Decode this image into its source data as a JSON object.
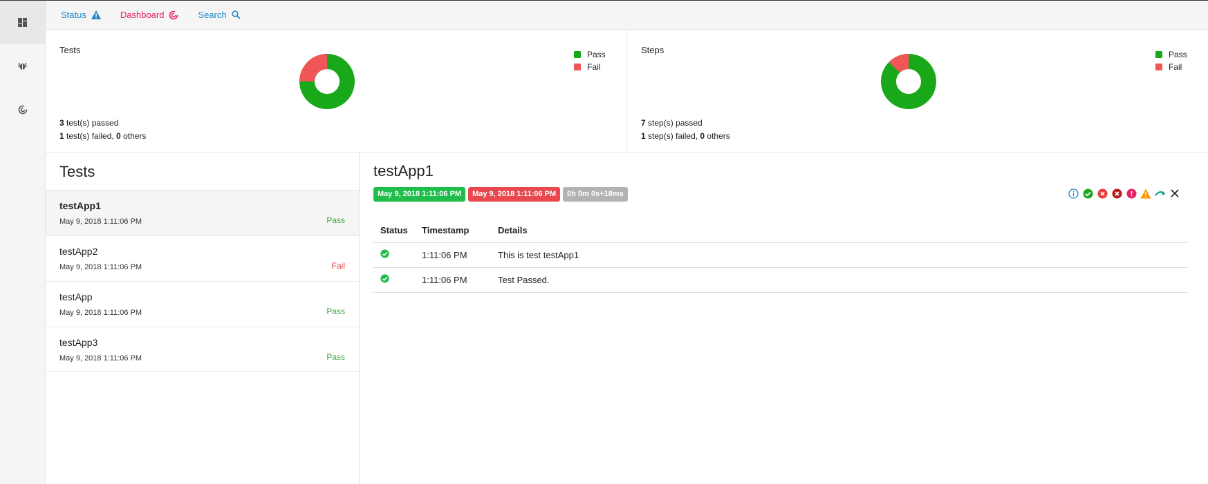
{
  "nav": {
    "status_label": "Status",
    "dashboard_label": "Dashboard",
    "search_label": "Search"
  },
  "colors": {
    "pass": "#19a819",
    "fail": "#f05557",
    "accent_blue": "#1e88c7",
    "accent_pink": "#e91e63"
  },
  "summary": {
    "tests": {
      "title": "Tests",
      "passed_count": "3",
      "passed_text": " test(s) passed",
      "failed_count": "1",
      "failed_text": " test(s) failed, ",
      "others_count": "0",
      "others_text": " others",
      "legend_pass": "Pass",
      "legend_fail": "Fail",
      "pass": 3,
      "fail": 1
    },
    "steps": {
      "title": "Steps",
      "passed_count": "7",
      "passed_text": " step(s) passed",
      "failed_count": "1",
      "failed_text": " step(s) failed, ",
      "others_count": "0",
      "others_text": " others",
      "legend_pass": "Pass",
      "legend_fail": "Fail",
      "pass": 7,
      "fail": 1
    }
  },
  "tests_pane": {
    "heading": "Tests",
    "items": [
      {
        "name": "testApp1",
        "date": "May 9, 2018 1:11:06 PM",
        "status": "Pass"
      },
      {
        "name": "testApp2",
        "date": "May 9, 2018 1:11:06 PM",
        "status": "Fail"
      },
      {
        "name": "testApp",
        "date": "May 9, 2018 1:11:06 PM",
        "status": "Pass"
      },
      {
        "name": "testApp3",
        "date": "May 9, 2018 1:11:06 PM",
        "status": "Pass"
      }
    ]
  },
  "detail": {
    "title": "testApp1",
    "start_time": "May 9, 2018 1:11:06 PM",
    "end_time": "May 9, 2018 1:11:06 PM",
    "duration": "0h 0m 0s+18ms",
    "columns": [
      "Status",
      "Timestamp",
      "Details"
    ],
    "logs": [
      {
        "status": "pass",
        "timestamp": "1:11:06 PM",
        "details": "This is test testApp1"
      },
      {
        "status": "pass",
        "timestamp": "1:11:06 PM",
        "details": "Test Passed."
      }
    ],
    "filter_icons": [
      "info-icon",
      "pass-icon",
      "fail-icon",
      "fatal-icon",
      "error-icon",
      "warning-icon",
      "skip-icon",
      "clear-icon"
    ]
  }
}
